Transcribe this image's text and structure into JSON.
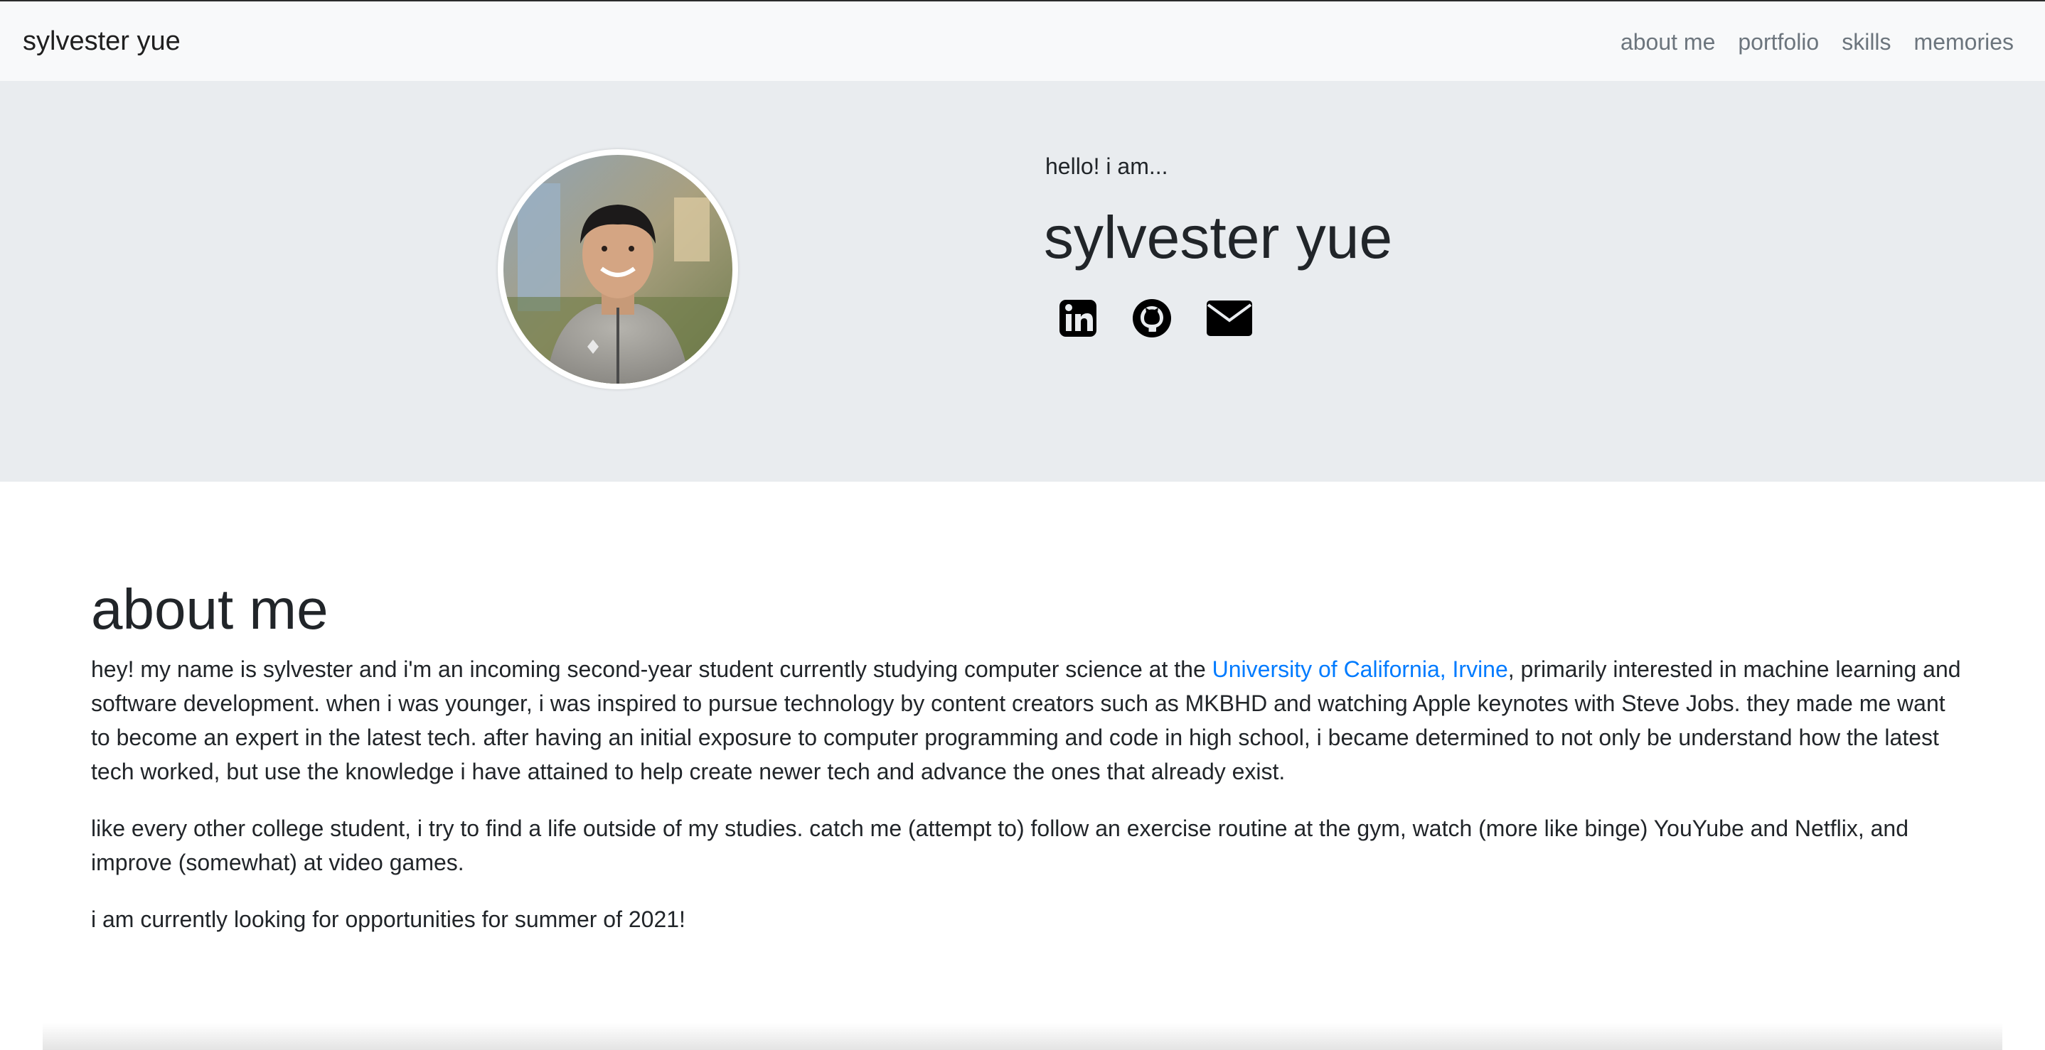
{
  "navbar": {
    "brand": "sylvester yue",
    "links": [
      "about me",
      "portfolio",
      "skills",
      "memories"
    ]
  },
  "hero": {
    "greeting": "hello! i am...",
    "name": "sylvester yue",
    "social_icons": [
      "linkedin-icon",
      "github-icon",
      "email-icon"
    ]
  },
  "about": {
    "title": "about me",
    "p1_before": "hey! my name is sylvester and i'm an incoming second-year student currently studying computer science at the ",
    "p1_link": "University of California, Irvine",
    "p1_after": ", primarily interested in machine learning and software development. when i was younger, i was inspired to pursue technology by content creators such as MKBHD and watching Apple keynotes with Steve Jobs. they made me want to become an expert in the latest tech. after having an initial exposure to computer programming and code in high school, i became determined to not only be understand how the latest tech worked, but use the knowledge i have attained to help create newer tech and advance the ones that already exist.",
    "p2": "like every other college student, i try to find a life outside of my studies. catch me (attempt to) follow an exercise routine at the gym, watch (more like binge) YouYube and Netflix, and improve (somewhat) at video games.",
    "p3": "i am currently looking for opportunities for summer of 2021!"
  },
  "colors": {
    "navbar_bg": "#f8f9fa",
    "hero_bg": "#e9ecef",
    "link": "#007bff",
    "nav_link": "#6c757d"
  }
}
